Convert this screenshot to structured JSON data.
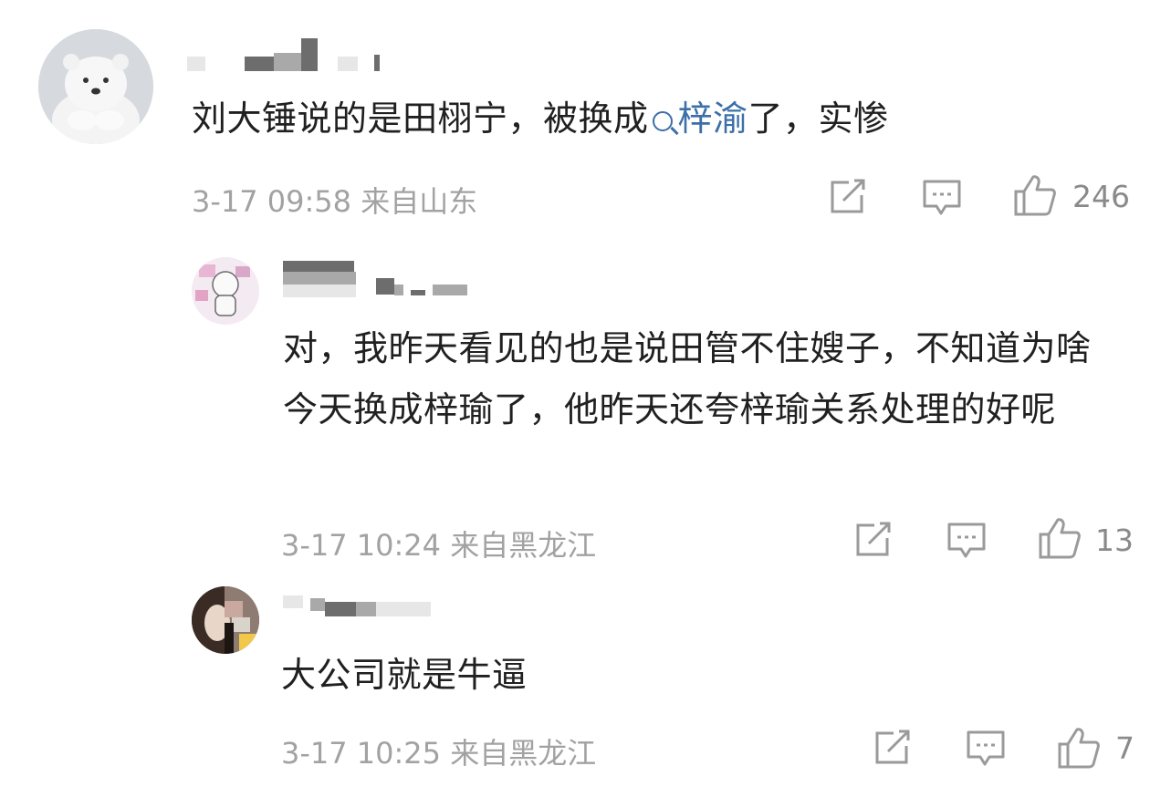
{
  "colors": {
    "link": "#3c6fa8",
    "meta": "#a2a2a2",
    "icon": "#9a9a9a"
  },
  "comments": [
    {
      "username": "",
      "text_before": "刘大锤说的是田栩宁，被换成",
      "topic_link": "梓渝",
      "text_after": "了，实惨",
      "time": "3-17 09:58",
      "location": "来自山东",
      "likes": "246",
      "icons": [
        "share-icon",
        "comment-icon",
        "like-icon"
      ]
    },
    {
      "username": "",
      "text": "对，我昨天看见的也是说田管不住嫂子，不知道为啥今天换成梓瑜了，他昨天还夸梓瑜关系处理的好呢",
      "time": "3-17 10:24",
      "location": "来自黑龙江",
      "likes": "13",
      "icons": [
        "share-icon",
        "comment-icon",
        "like-icon"
      ]
    },
    {
      "username": "",
      "text": "大公司就是牛逼",
      "time": "3-17 10:25",
      "location": "来自黑龙江",
      "likes": "7",
      "icons": [
        "share-icon",
        "comment-icon",
        "like-icon"
      ]
    }
  ]
}
